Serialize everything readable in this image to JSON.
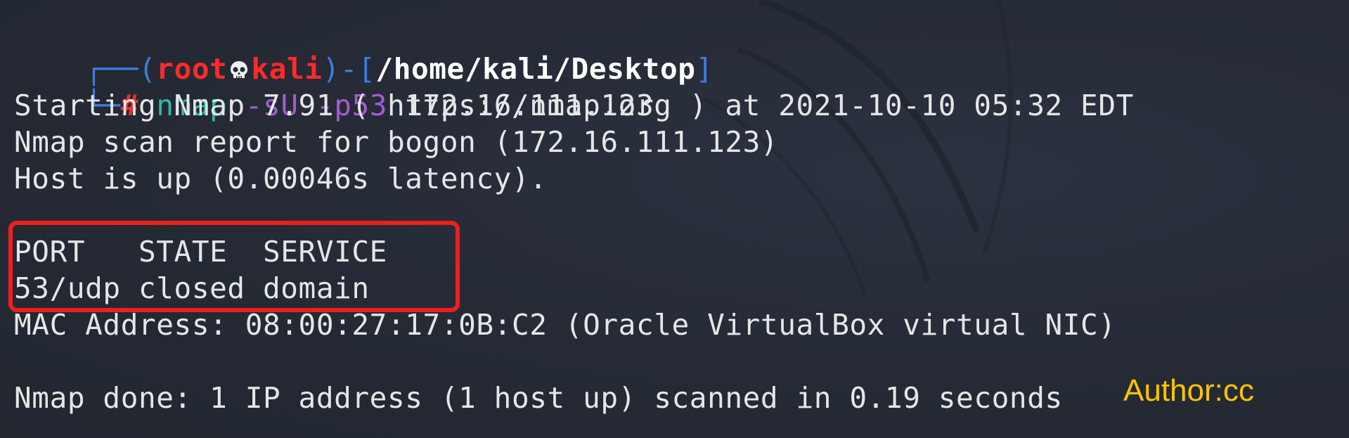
{
  "prompt": {
    "frame_top_left": "┌──(",
    "user": "root",
    "skull_icon": "skull-icon",
    "host": "kali",
    "frame_mid": ")-[",
    "path": "/home/kali/Desktop",
    "frame_end": "]",
    "frame_bottom_left": "└─",
    "hash": "#"
  },
  "command": {
    "name": "nmap",
    "opt1": "-sU",
    "opt2": "-p53",
    "target": "172.16.111.123"
  },
  "output": {
    "starting": "Starting Nmap 7.91 ( https://nmap.org ) at 2021-10-10 05:32 EDT",
    "report": "Nmap scan report for bogon (172.16.111.123)",
    "host_up": "Host is up (0.00046s latency).",
    "table_header": "PORT   STATE  SERVICE",
    "table_row": "53/udp closed domain",
    "mac": "MAC Address: 08:00:27:17:0B:C2 (Oracle VirtualBox virtual NIC)",
    "done": "Nmap done: 1 IP address (1 host up) scanned in 0.19 seconds"
  },
  "author": "Author:cc",
  "colors": {
    "background": "#262b36",
    "prompt_frame": "#3b7de0",
    "prompt_user": "#ff2a2a",
    "command": "#35b7a6",
    "options": "#a25bd3",
    "highlight_box": "#f01e1e",
    "author": "#ffc400"
  }
}
